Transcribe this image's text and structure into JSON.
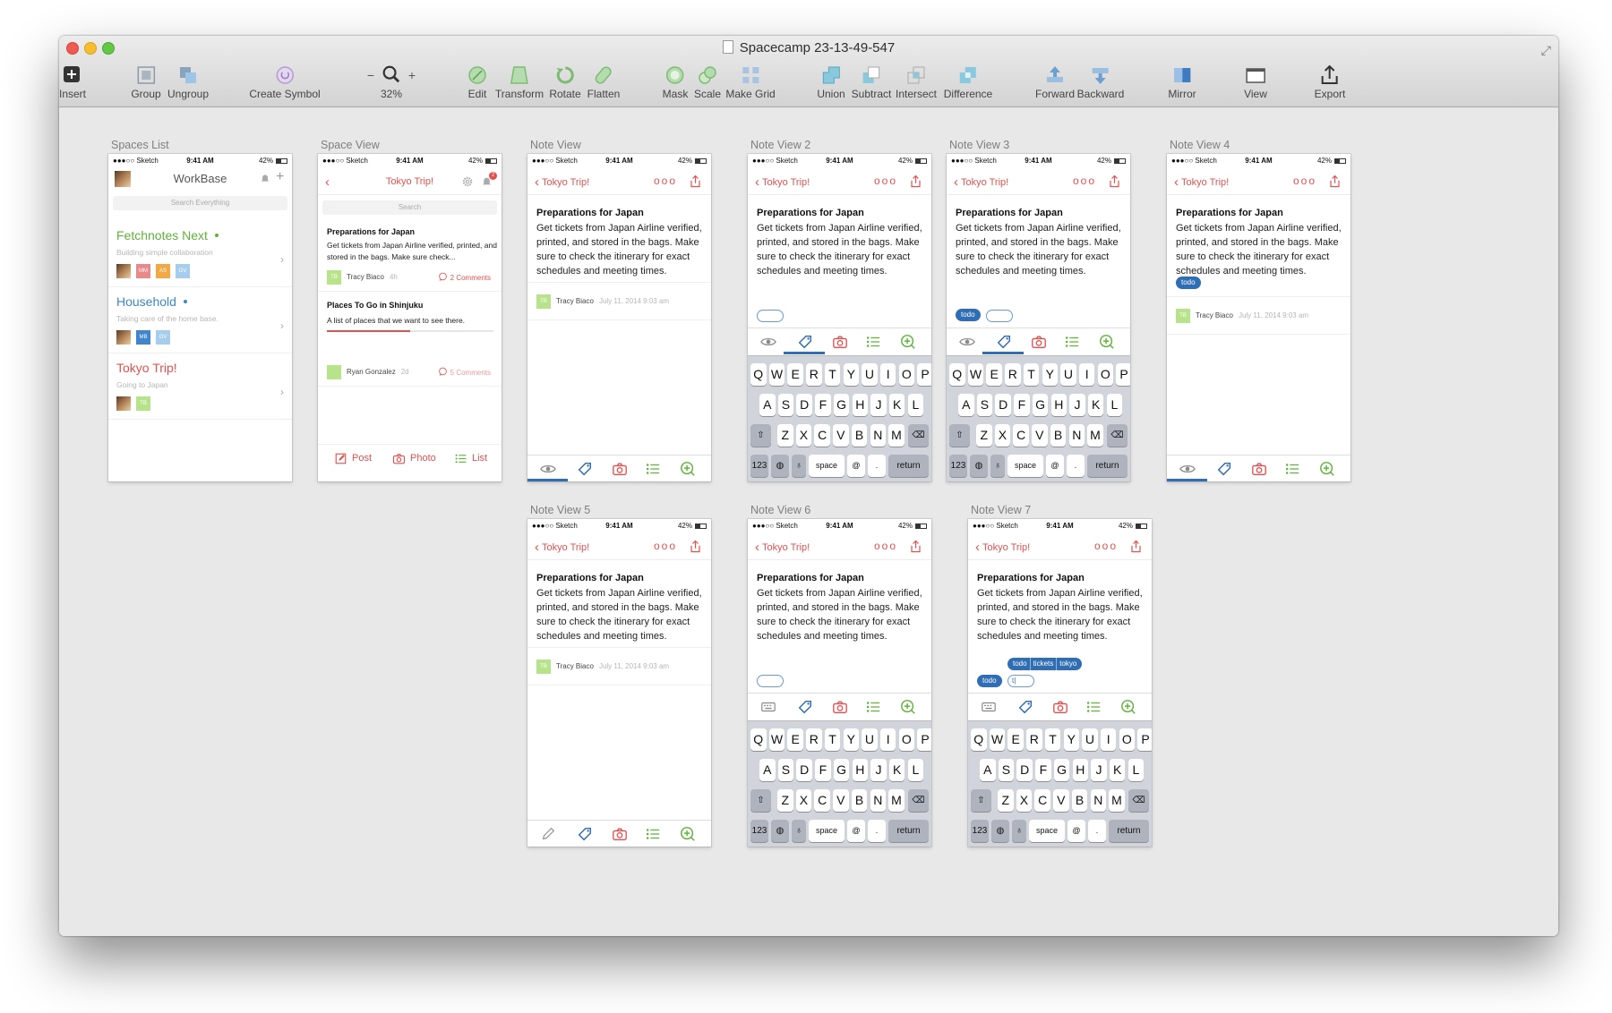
{
  "window": {
    "title": "Spacecamp 23-13-49-547"
  },
  "toolbar": {
    "insert": "Insert",
    "group": "Group",
    "ungroup": "Ungroup",
    "create_symbol": "Create Symbol",
    "zoom_minus": "−",
    "zoom_plus": "+",
    "zoom_level": "32%",
    "edit": "Edit",
    "transform": "Transform",
    "rotate": "Rotate",
    "flatten": "Flatten",
    "mask": "Mask",
    "scale": "Scale",
    "make_grid": "Make Grid",
    "union": "Union",
    "subtract": "Subtract",
    "intersect": "Intersect",
    "difference": "Difference",
    "forward": "Forward",
    "backward": "Backward",
    "mirror": "Mirror",
    "view": "View",
    "export": "Export"
  },
  "statusbar": {
    "carrier": "●●●○○ Sketch",
    "time": "9:41 AM",
    "battery": "42%"
  },
  "artboards": {
    "spaces_list": "Spaces List",
    "space_view": "Space View",
    "note_view": "Note View",
    "note_view_2": "Note View 2",
    "note_view_3": "Note View 3",
    "note_view_4": "Note View 4",
    "note_view_5": "Note View 5",
    "note_view_6": "Note View 6",
    "note_view_7": "Note View 7"
  },
  "spaces": {
    "title": "WorkBase",
    "search": "Search Everything",
    "items": [
      {
        "name": "Fetchnotes Next",
        "sub": "Building simple collaboration",
        "color": "#5fb23a",
        "avatars": [
          "MM",
          "AS",
          "GV"
        ]
      },
      {
        "name": "Household",
        "sub": "Taking care of the home base.",
        "color": "#3d86c9",
        "avatars": [
          "MB",
          "GV"
        ]
      },
      {
        "name": "Tokyo Trip!",
        "sub": "Going to Japan",
        "color": "#e4504f",
        "avatars": [
          "TB"
        ]
      }
    ]
  },
  "space_view": {
    "title": "Tokyo Trip!",
    "badge": "2",
    "search": "Search",
    "notes": [
      {
        "title": "Preparations for Japan",
        "body": "Get tickets from Japan Airline verified, printed, and stored in the bags. Make sure check...",
        "author_initials": "TB",
        "author": "Tracy Biaco",
        "age": "4h",
        "comments": "2 Comments"
      },
      {
        "title": "Places To Go in Shinjuku",
        "body": "A list of places that we want to see there.",
        "author": "Ryan Gonzalez",
        "age": "2d",
        "comments": "5 Comments",
        "progress": 0.5
      }
    ],
    "actions": {
      "post": "Post",
      "photo": "Photo",
      "list": "List"
    }
  },
  "note": {
    "back": "Tokyo Trip!",
    "more": "ooo",
    "title": "Preparations for Japan",
    "body": "Get tickets from Japan Airline verified, printed, and stored in the bags. Make sure to check the itinerary for exact schedules and meeting times.",
    "author_initials": "TB",
    "author": "Tracy Biaco",
    "date": "July 11, 2014 9:03 am",
    "tag": "todo",
    "typed_tag": "t|",
    "suggestions": [
      "todo",
      "tickets",
      "tokyo"
    ]
  },
  "keyboard": {
    "row1": [
      "Q",
      "W",
      "E",
      "R",
      "T",
      "Y",
      "U",
      "I",
      "O",
      "P"
    ],
    "row2": [
      "A",
      "S",
      "D",
      "F",
      "G",
      "H",
      "J",
      "K",
      "L"
    ],
    "row3": [
      "Z",
      "X",
      "C",
      "V",
      "B",
      "N",
      "M"
    ],
    "num": "123",
    "space": "space",
    "at": "@",
    "dot": ".",
    "ret": "return"
  },
  "colors": {
    "accent_red": "#e4504f",
    "accent_blue": "#2f6db4",
    "accent_green": "#5fb23a"
  }
}
